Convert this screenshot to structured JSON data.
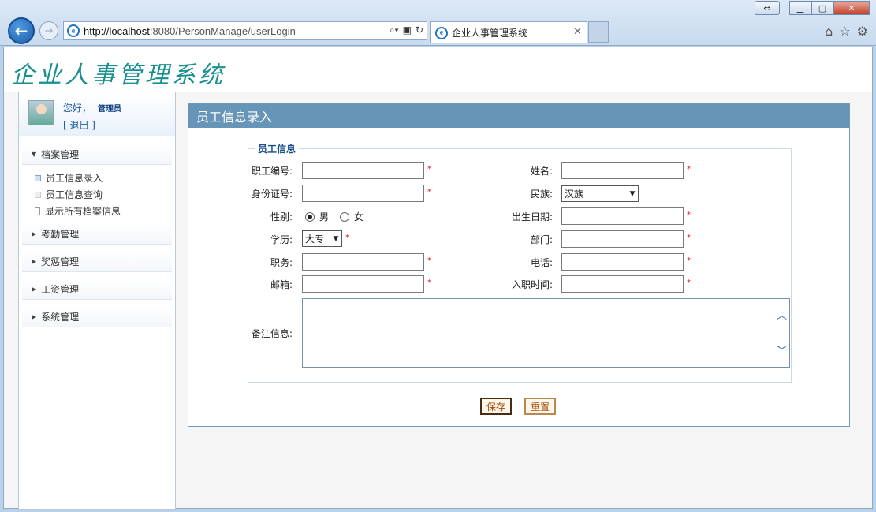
{
  "browser": {
    "url": "http://localhost:8080/PersonManage/userLogin",
    "tab_title": "企业人事管理系统",
    "url_host": "http://localhost",
    "url_rest": ":8080/PersonManage/userLogin"
  },
  "app": {
    "logo_text": "企业人事管理系统"
  },
  "user": {
    "greeting": "您好，",
    "role": "管理员",
    "logout": "[ 退出 ]"
  },
  "sidebar": {
    "sections": [
      {
        "label": "档案管理",
        "expanded": true,
        "items": [
          "员工信息录入",
          "员工信息查询",
          "显示所有档案信息"
        ]
      },
      {
        "label": "考勤管理"
      },
      {
        "label": "奖惩管理"
      },
      {
        "label": "工资管理"
      },
      {
        "label": "系统管理"
      }
    ]
  },
  "panel": {
    "title": "员工信息录入",
    "legend": "员工信息"
  },
  "form": {
    "emp_no_label": "职工编号:",
    "name_label": "姓名:",
    "id_label": "身份证号:",
    "ethnic_label": "民族:",
    "ethnic_value": "汉族",
    "gender_label": "性别:",
    "male": "男",
    "female": "女",
    "birth_label": "出生日期:",
    "edu_label": "学历:",
    "edu_value": "大专",
    "dept_label": "部门:",
    "job_label": "职务:",
    "phone_label": "电话:",
    "email_label": "邮箱:",
    "hire_label": "入职时间:",
    "remark_label": "备注信息:",
    "required_mark": "*"
  },
  "buttons": {
    "save": "保存",
    "reset": "重置"
  }
}
